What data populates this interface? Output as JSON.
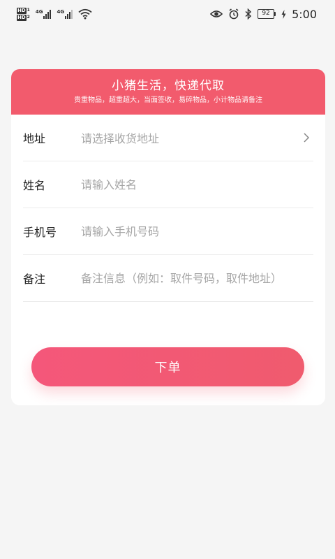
{
  "status_bar": {
    "sim1_label": "HD",
    "sim1_num": "1",
    "sim2_label": "HD",
    "sim2_num": "2",
    "net1": "4G",
    "net2": "4G",
    "battery": "92",
    "time": "5:00"
  },
  "banner": {
    "title": "小猪生活，快递代取",
    "subtitle": "贵重物品，超重超大，当面签收，易碎物品，小计物品请备注"
  },
  "form": {
    "address": {
      "label": "地址",
      "placeholder": "请选择收货地址"
    },
    "name": {
      "label": "姓名",
      "placeholder": "请输入姓名"
    },
    "phone": {
      "label": "手机号",
      "placeholder": "请输入手机号码"
    },
    "note": {
      "label": "备注",
      "placeholder": "备注信息（例如：取件号码，取件地址）"
    }
  },
  "submit_label": "下单",
  "colors": {
    "accent": "#f25b6d",
    "background": "#f5f5f5"
  }
}
